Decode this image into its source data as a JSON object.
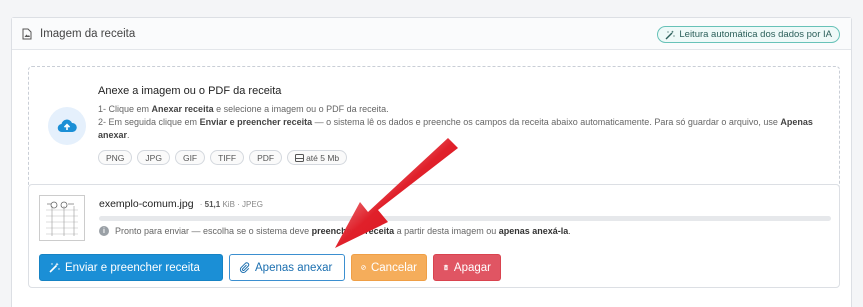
{
  "header": {
    "title": "Imagem da receita",
    "ai_badge": "Leitura automática dos dados por IA"
  },
  "dropzone": {
    "title": "Anexe a imagem ou o PDF da receita",
    "line1_pre": "1- Clique em ",
    "line1_bold": "Anexar receita",
    "line1_post": " e selecione a imagem ou o PDF da receita.",
    "line2_pre": "2- Em seguida clique em ",
    "line2_bold": "Enviar e preencher receita",
    "line2_post": " — o sistema lê os dados e preenche os campos da receita abaixo automaticamente. Para só guardar o arquivo, use ",
    "line2_bold2": "Apenas anexar",
    "line2_end": ".",
    "formats": [
      "PNG",
      "JPG",
      "GIF",
      "TIFF",
      "PDF"
    ],
    "max_size": "até 5 Mb"
  },
  "file": {
    "name": "exemplo-comum.jpg",
    "size": "51,1",
    "size_unit": " KiB · JPEG",
    "progress_fraction": 0,
    "status_pre": "Pronto para enviar — escolha se o sistema deve ",
    "status_bold1": "preencher a receita",
    "status_mid": " a partir desta imagem ou ",
    "status_bold2": "apenas anexá-la",
    "status_end": "."
  },
  "actions": {
    "send_fill": "Enviar e preencher receita",
    "attach_only": "Apenas anexar",
    "cancel": "Cancelar",
    "delete": "Apagar"
  },
  "colors": {
    "primary": "#1b8fd6",
    "warning": "#f5ad5b",
    "danger": "#e05563",
    "annotation_arrow": "#e0202a"
  }
}
